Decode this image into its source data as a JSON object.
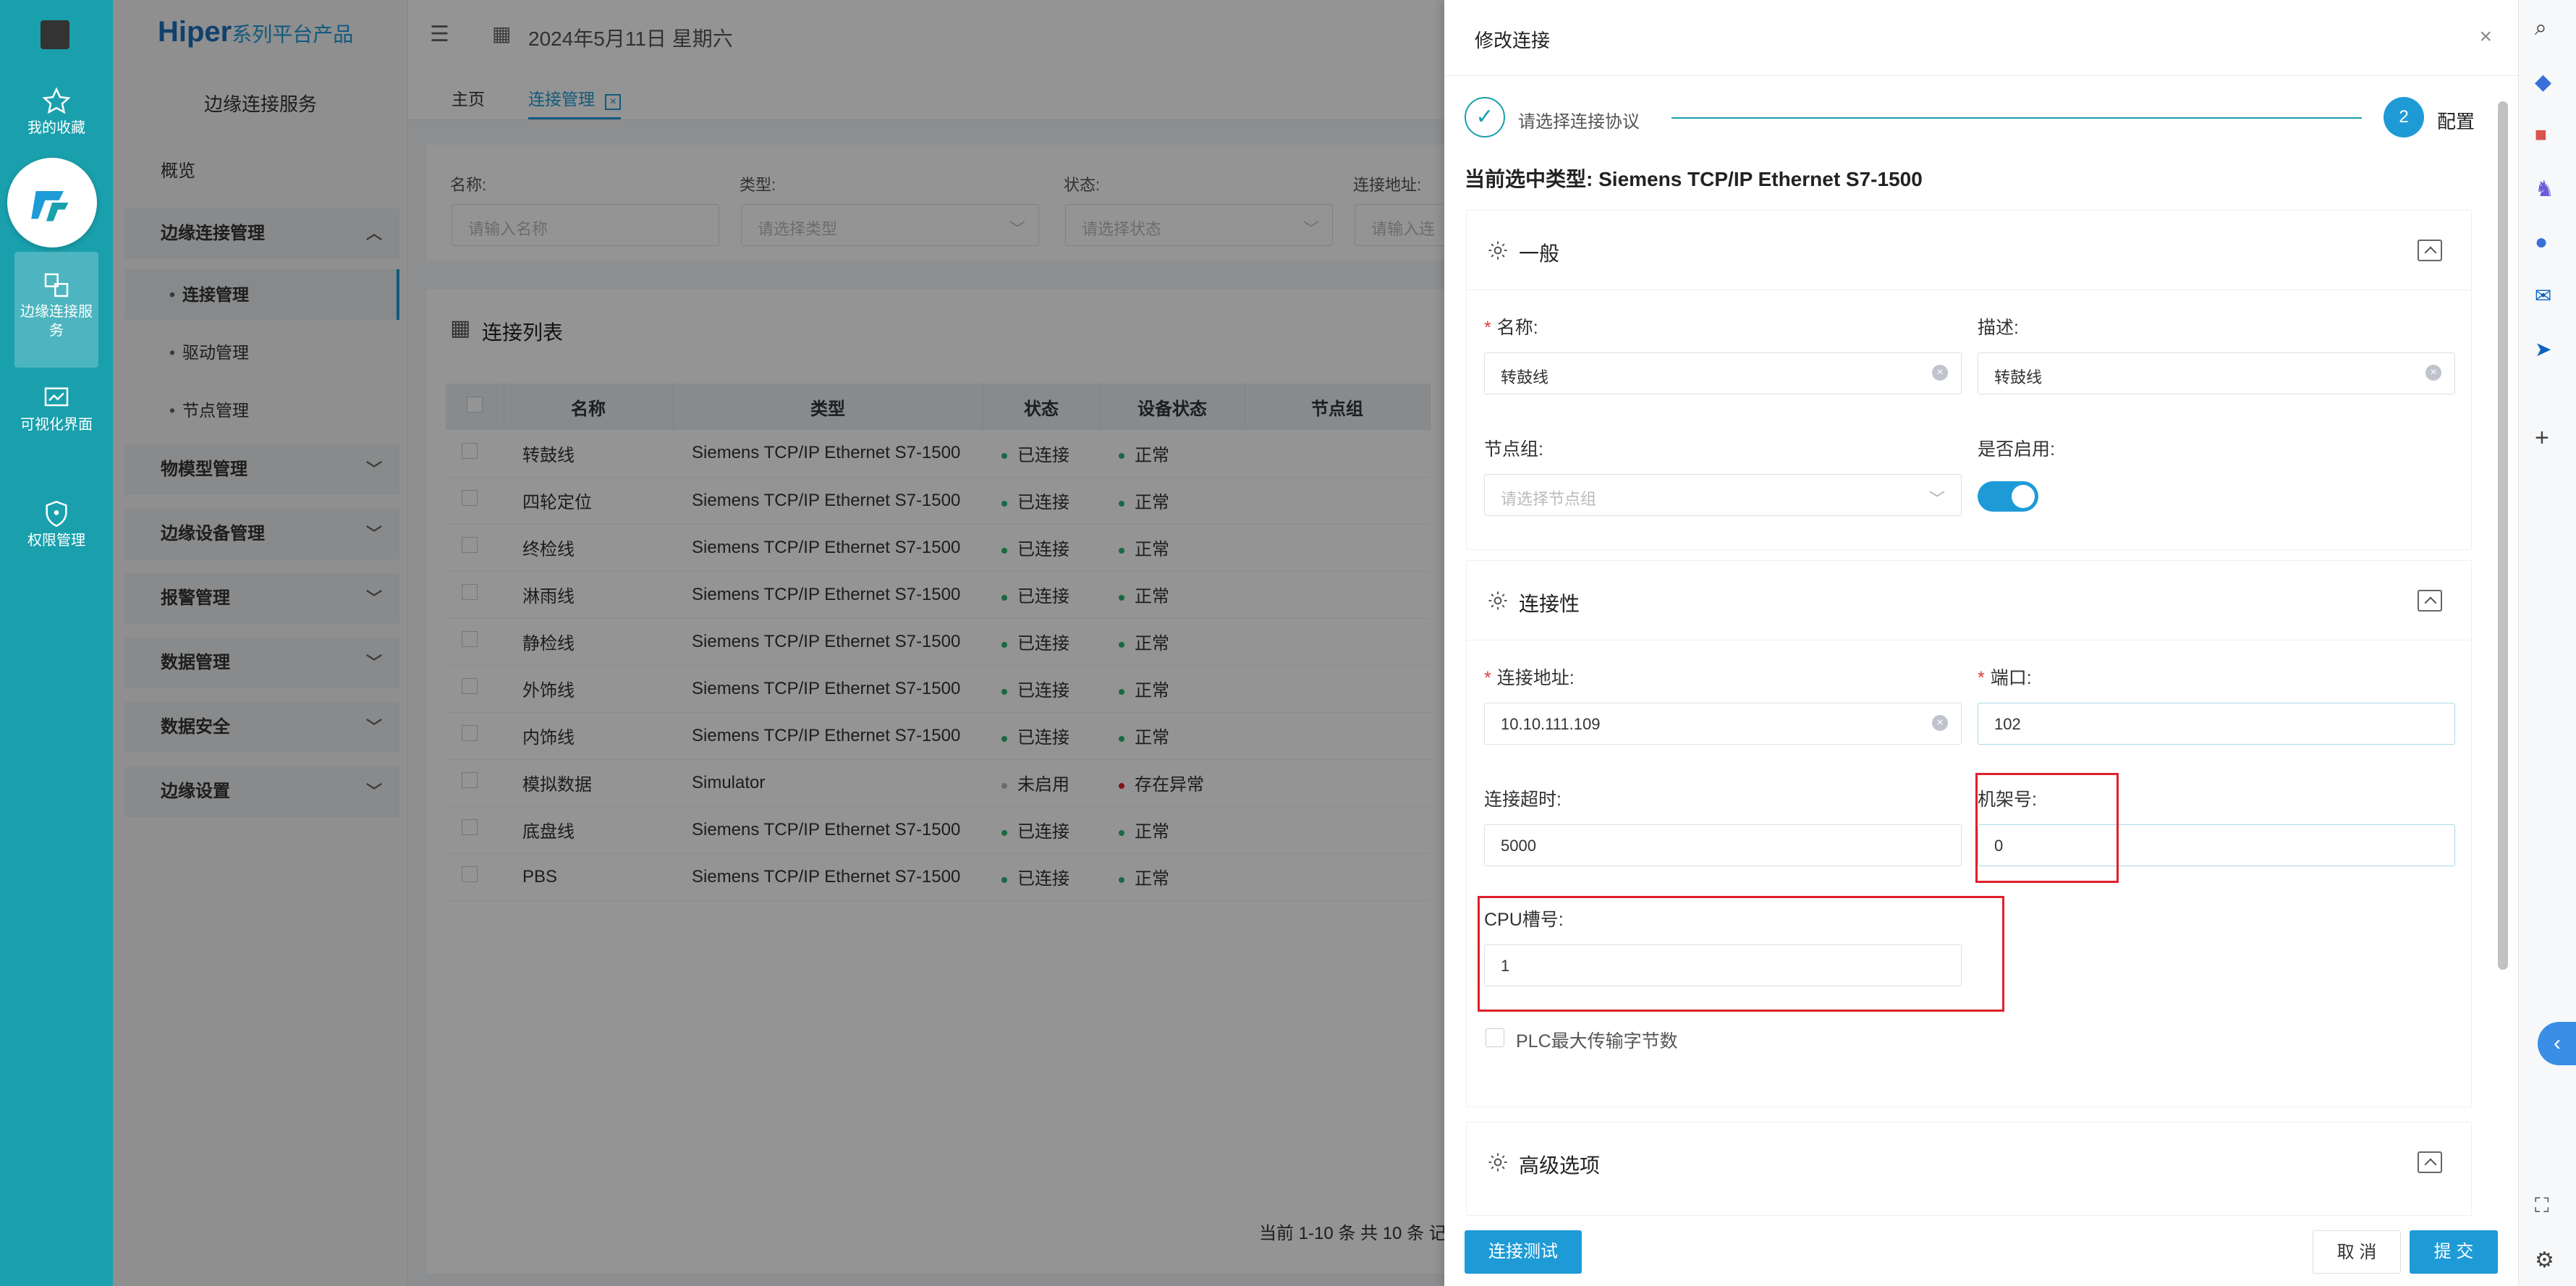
{
  "rail": {
    "items": [
      {
        "label": "我的收藏",
        "icon": "star-icon"
      },
      {
        "label": "边缘连接服务",
        "icon": "connection-icon"
      },
      {
        "label": "可视化界面",
        "icon": "chart-screen-icon"
      },
      {
        "label": "权限管理",
        "icon": "shield-icon"
      }
    ]
  },
  "brand": {
    "name": "Hiper",
    "suffix": "系列平台产品"
  },
  "header": {
    "date": "2024年5月11日 星期六"
  },
  "sidebar": {
    "title": "边缘连接服务",
    "items": [
      {
        "label": "概览"
      },
      {
        "label": "边缘连接管理"
      },
      {
        "label": "连接管理"
      },
      {
        "label": "驱动管理"
      },
      {
        "label": "节点管理"
      },
      {
        "label": "物模型管理"
      },
      {
        "label": "边缘设备管理"
      },
      {
        "label": "报警管理"
      },
      {
        "label": "数据管理"
      },
      {
        "label": "数据安全"
      },
      {
        "label": "边缘设置"
      }
    ]
  },
  "tabs": {
    "home": "主页",
    "active": "连接管理"
  },
  "filters": {
    "name": {
      "label": "名称:",
      "placeholder": "请输入名称"
    },
    "type": {
      "label": "类型:",
      "placeholder": "请选择类型"
    },
    "status": {
      "label": "状态:",
      "placeholder": "请选择状态"
    },
    "address": {
      "label": "连接地址:",
      "placeholder": "请输入连"
    }
  },
  "list": {
    "title": "连接列表",
    "columns": [
      "名称",
      "类型",
      "状态",
      "设备状态",
      "节点组"
    ],
    "rows": [
      {
        "name": "转鼓线",
        "type": "Siemens TCP/IP Ethernet S7-1500",
        "status": "已连接",
        "device": "正常"
      },
      {
        "name": "四轮定位",
        "type": "Siemens TCP/IP Ethernet S7-1500",
        "status": "已连接",
        "device": "正常"
      },
      {
        "name": "终检线",
        "type": "Siemens TCP/IP Ethernet S7-1500",
        "status": "已连接",
        "device": "正常"
      },
      {
        "name": "淋雨线",
        "type": "Siemens TCP/IP Ethernet S7-1500",
        "status": "已连接",
        "device": "正常"
      },
      {
        "name": "静检线",
        "type": "Siemens TCP/IP Ethernet S7-1500",
        "status": "已连接",
        "device": "正常"
      },
      {
        "name": "外饰线",
        "type": "Siemens TCP/IP Ethernet S7-1500",
        "status": "已连接",
        "device": "正常"
      },
      {
        "name": "内饰线",
        "type": "Siemens TCP/IP Ethernet S7-1500",
        "status": "已连接",
        "device": "正常"
      },
      {
        "name": "模拟数据",
        "type": "Simulator",
        "status": "未启用",
        "device": "存在异常"
      },
      {
        "name": "底盘线",
        "type": "Siemens TCP/IP Ethernet S7-1500",
        "status": "已连接",
        "device": "正常"
      },
      {
        "name": "PBS",
        "type": "Siemens TCP/IP Ethernet S7-1500",
        "status": "已连接",
        "device": "正常"
      }
    ],
    "pagination": "当前 1-10 条 共 10 条 记"
  },
  "drawer": {
    "title": "修改连接",
    "close": "×",
    "step1": "请选择连接协议",
    "step2_num": "2",
    "step2": "配置",
    "current_type_label": "当前选中类型:",
    "current_type": "Siemens TCP/IP Ethernet S7-1500",
    "general": {
      "title": "一般",
      "name_label": "名称:",
      "name_value": "转鼓线",
      "desc_label": "描述:",
      "desc_value": "转鼓线",
      "group_label": "节点组:",
      "group_placeholder": "请选择节点组",
      "enabled_label": "是否启用:"
    },
    "connectivity": {
      "title": "连接性",
      "address_label": "连接地址:",
      "address_value": "10.10.111.109",
      "port_label": "端口:",
      "port_value": "102",
      "timeout_label": "连接超时:",
      "timeout_value": "5000",
      "rack_label": "机架号:",
      "rack_value": "0",
      "slot_label": "CPU槽号:",
      "slot_value": "1",
      "pdu_label": "PLC最大传输字节数"
    },
    "advanced": {
      "title": "高级选项"
    },
    "test_button": "连接测试",
    "cancel_button": "取 消",
    "submit_button": "提 交"
  },
  "colors": {
    "accent": "#1aa0ad",
    "primary": "#1e9bd7",
    "highlight": "#e0202a"
  }
}
